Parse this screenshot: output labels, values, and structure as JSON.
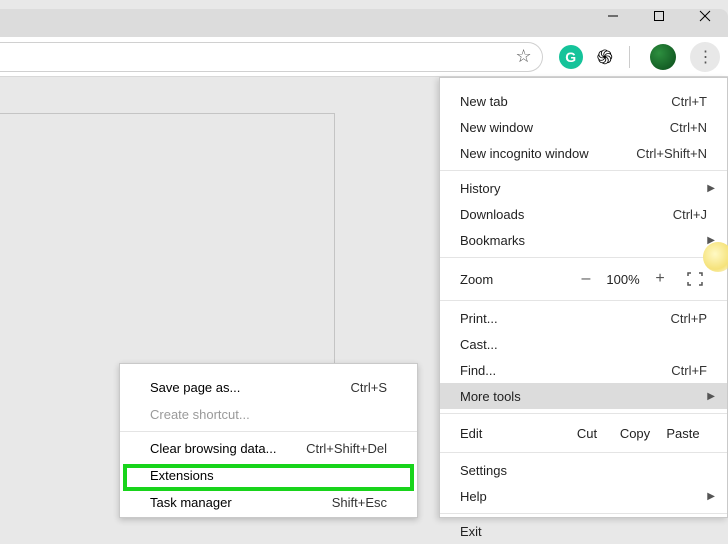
{
  "window_controls": {
    "minimize": "–",
    "maximize": "□",
    "close": "✕"
  },
  "main_menu": {
    "new_tab": {
      "label": "New tab",
      "shortcut": "Ctrl+T"
    },
    "new_window": {
      "label": "New window",
      "shortcut": "Ctrl+N"
    },
    "new_incognito": {
      "label": "New incognito window",
      "shortcut": "Ctrl+Shift+N"
    },
    "history": {
      "label": "History"
    },
    "downloads": {
      "label": "Downloads",
      "shortcut": "Ctrl+J"
    },
    "bookmarks": {
      "label": "Bookmarks"
    },
    "zoom": {
      "label": "Zoom",
      "minus": "–",
      "value": "100%",
      "plus": "+"
    },
    "print": {
      "label": "Print...",
      "shortcut": "Ctrl+P"
    },
    "cast": {
      "label": "Cast..."
    },
    "find": {
      "label": "Find...",
      "shortcut": "Ctrl+F"
    },
    "more_tools": {
      "label": "More tools"
    },
    "edit": {
      "label": "Edit",
      "cut": "Cut",
      "copy": "Copy",
      "paste": "Paste"
    },
    "settings": {
      "label": "Settings"
    },
    "help": {
      "label": "Help"
    },
    "exit": {
      "label": "Exit"
    }
  },
  "submenu": {
    "save_page": {
      "label": "Save page as...",
      "shortcut": "Ctrl+S"
    },
    "create_shortcut": {
      "label": "Create shortcut..."
    },
    "clear_data": {
      "label": "Clear browsing data...",
      "shortcut": "Ctrl+Shift+Del"
    },
    "extensions": {
      "label": "Extensions"
    },
    "task_manager": {
      "label": "Task manager",
      "shortcut": "Shift+Esc"
    }
  }
}
